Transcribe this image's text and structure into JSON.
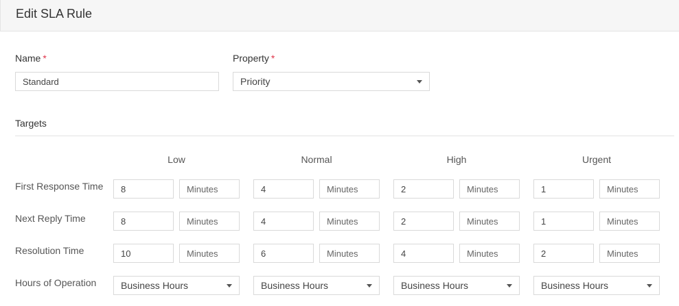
{
  "header": {
    "title": "Edit SLA Rule"
  },
  "form": {
    "name_label": "Name",
    "required_mark": "*",
    "name_value": "Standard",
    "property_label": "Property",
    "property_value": "Priority"
  },
  "targets": {
    "title": "Targets",
    "columns": [
      "Low",
      "Normal",
      "High",
      "Urgent"
    ],
    "rows": [
      {
        "label": "First Response Time",
        "values": [
          "8",
          "4",
          "2",
          "1"
        ],
        "units": [
          "Minutes",
          "Minutes",
          "Minutes",
          "Minutes"
        ]
      },
      {
        "label": "Next Reply Time",
        "values": [
          "8",
          "4",
          "2",
          "1"
        ],
        "units": [
          "Minutes",
          "Minutes",
          "Minutes",
          "Minutes"
        ]
      },
      {
        "label": "Resolution Time",
        "values": [
          "10",
          "6",
          "4",
          "2"
        ],
        "units": [
          "Minutes",
          "Minutes",
          "Minutes",
          "Minutes"
        ]
      }
    ],
    "hours": {
      "label": "Hours of Operation",
      "values": [
        "Business Hours",
        "Business Hours",
        "Business Hours",
        "Business Hours"
      ]
    }
  }
}
